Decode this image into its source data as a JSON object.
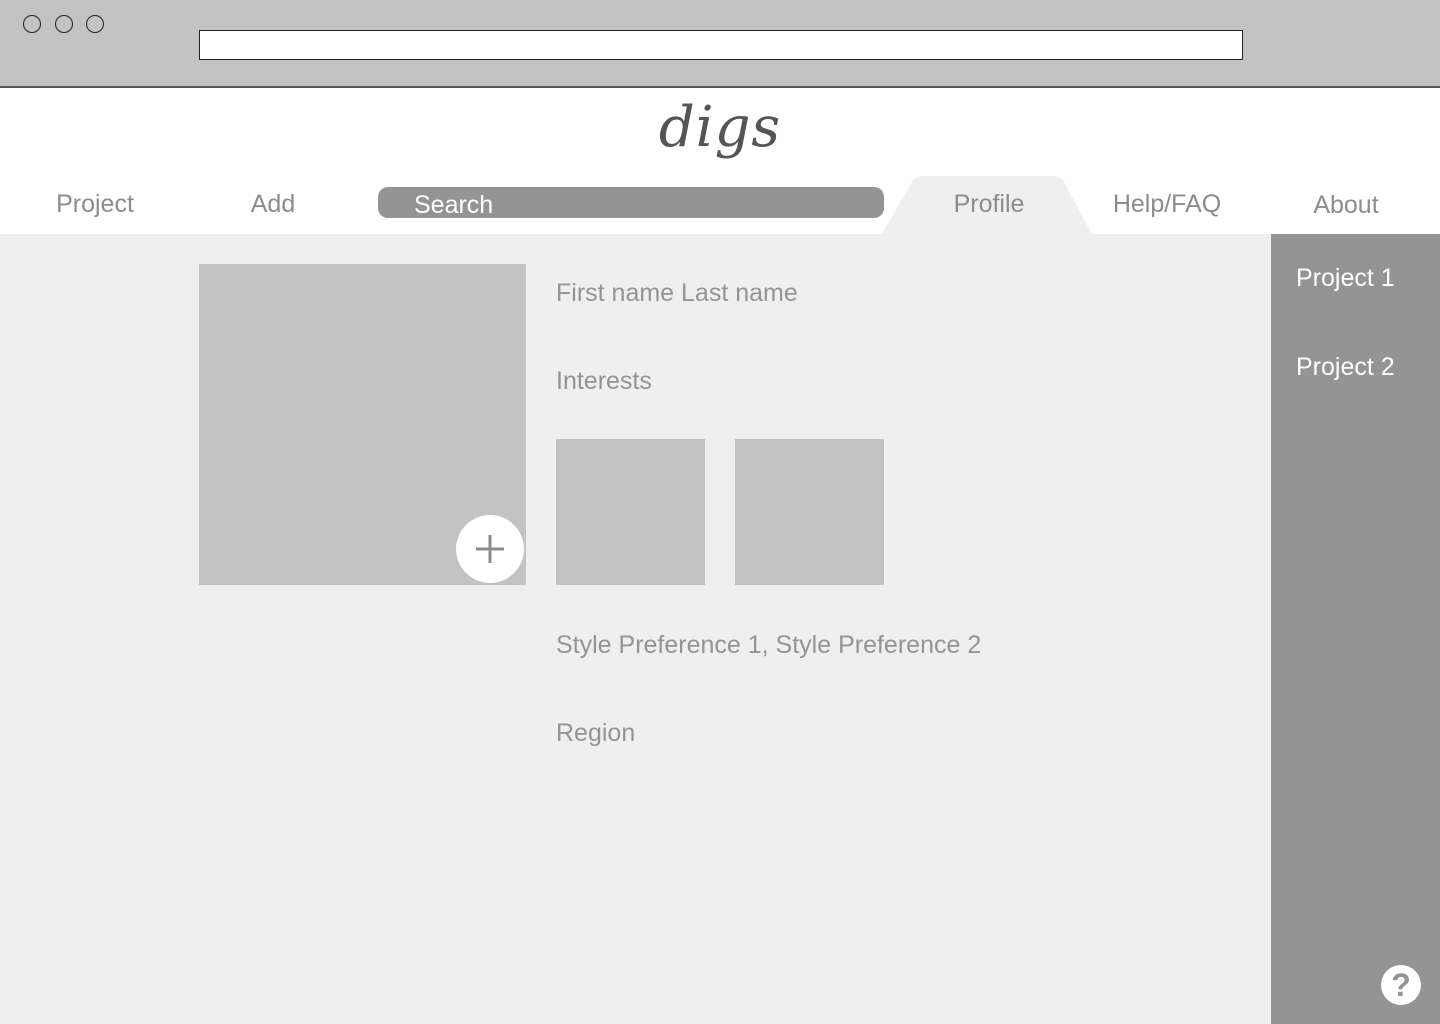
{
  "browser": {
    "address": ""
  },
  "app": {
    "logo": "digs"
  },
  "nav": {
    "project": "Project",
    "add": "Add",
    "search": "Search",
    "profile": "Profile",
    "help": "Help/FAQ",
    "about": "About",
    "active_tab": "Profile"
  },
  "sidebar": {
    "items": [
      {
        "label": "Project 1"
      },
      {
        "label": "Project 2"
      }
    ]
  },
  "profile": {
    "name": "First name Last name",
    "interests_label": "Interests",
    "style_preferences": "Style Preference 1, Style Preference 2",
    "region": "Region"
  },
  "icons": {
    "add_photo": "plus-icon",
    "help": "question-mark-icon",
    "help_glyph": "?"
  },
  "colors": {
    "chrome": "#c3c3c3",
    "nav_text": "#8c8c8c",
    "accent_gray": "#959494",
    "placeholder": "#c3c3c3",
    "content_bg": "#efefef"
  }
}
